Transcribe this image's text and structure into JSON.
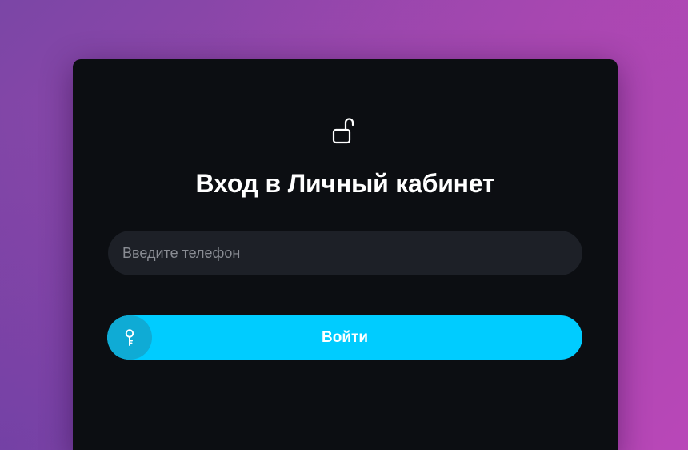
{
  "login": {
    "lock_icon": "unlocked-padlock-icon",
    "title": "Вход в Личный кабинет",
    "phone": {
      "placeholder": "Введите телефон",
      "value": ""
    },
    "submit": {
      "label": "Войти",
      "icon": "key-icon"
    }
  },
  "colors": {
    "card_bg": "#0c0e12",
    "input_bg": "#1d2027",
    "button_bg": "#00ccff",
    "button_icon_bg": "#0fabd5",
    "text": "#ffffff",
    "placeholder": "#8a8d94",
    "background_from": "#7b46a6",
    "background_to": "#b947b8"
  }
}
